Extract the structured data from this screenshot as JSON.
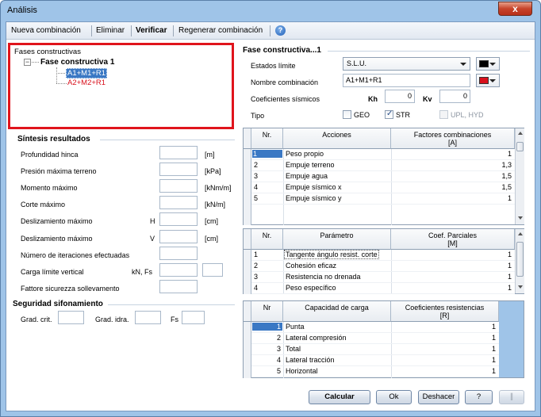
{
  "window": {
    "title": "Análisis",
    "close_glyph": "x"
  },
  "toolbar": {
    "new_combination": "Nueva combinación",
    "delete": "Eliminar",
    "verify": "Verificar",
    "regenerate": "Regenerar combinación",
    "help_glyph": "?"
  },
  "tree": {
    "root": "Fases constructivas",
    "phase": "Fase constructiva 1",
    "combinations": [
      "A1+M1+R1",
      "A2+M2+R1"
    ]
  },
  "synthesis": {
    "title": "Síntesis resultados",
    "rows": [
      {
        "label": "Profundidad  hinca",
        "value": "",
        "unit": "[m]"
      },
      {
        "label": "Presión máxima terreno",
        "value": "",
        "unit": "[kPa]"
      },
      {
        "label": "Momento máximo",
        "value": "",
        "unit": "[kNm/m]"
      },
      {
        "label": "Corte máximo",
        "value": "",
        "unit": "[kN/m]"
      },
      {
        "label": "Deslizamiento máximo",
        "sub": "H",
        "value": "",
        "unit": "[cm]"
      },
      {
        "label": "Deslizamiento máximo",
        "sub": "V",
        "value": "",
        "unit": "[cm]"
      },
      {
        "label": "Número de iteraciones efectuadas",
        "value": "",
        "unit": ""
      },
      {
        "label": "Carga límite vertical",
        "sub": "kN, Fs",
        "value": "",
        "value2": "",
        "unit": ""
      },
      {
        "label": "Fattore sicurezza sollevamento",
        "value": "",
        "unit": ""
      }
    ]
  },
  "siphon": {
    "title": "Seguridad sifonamiento",
    "crit_label": "Grad. crit.",
    "idra_label": "Grad. idra.",
    "fs_label": "Fs",
    "crit_value": "",
    "idra_value": "",
    "fs_value": ""
  },
  "phase_panel": {
    "title": "Fase constructiva...1",
    "limit_states_label": "Estados límite",
    "limit_state_value": "S.L.U.",
    "combination_name_label": "Nombre combinación",
    "combination_name_value": "A1+M1+R1",
    "seismic_label": "Coeficientes sísmicos",
    "kh_label": "Kh",
    "kh_value": "0",
    "kv_label": "Kv",
    "kv_value": "0",
    "type_label": "Tipo",
    "geo_label": "GEO",
    "str_label": "STR",
    "upl_label": "UPL, HYD",
    "color1": "#000000",
    "color2": "#d8101c"
  },
  "actions_table": {
    "headers": [
      "Nr.",
      "Acciones",
      "Factores combinaciones\n[A]"
    ],
    "rows": [
      {
        "nr": "1",
        "name": "Peso propio",
        "factor": "1"
      },
      {
        "nr": "2",
        "name": "Empuje terreno",
        "factor": "1,3"
      },
      {
        "nr": "3",
        "name": "Empuje agua",
        "factor": "1,5"
      },
      {
        "nr": "4",
        "name": "Empuje sísmico x",
        "factor": "1,5"
      },
      {
        "nr": "5",
        "name": "Empuje sísmico y",
        "factor": "1"
      }
    ]
  },
  "params_table": {
    "headers": [
      "Nr.",
      "Parámetro",
      "Coef. Parciales\n[M]"
    ],
    "rows": [
      {
        "nr": "1",
        "name": "Tangente ángulo resist. corte",
        "factor": "1"
      },
      {
        "nr": "2",
        "name": "Cohesión eficaz",
        "factor": "1"
      },
      {
        "nr": "3",
        "name": "Resistencia no drenada",
        "factor": "1"
      },
      {
        "nr": "4",
        "name": "Peso específico",
        "factor": "1"
      }
    ]
  },
  "capacity_table": {
    "headers": [
      "Nr",
      "Capacidad de carga",
      "Coeficientes resistencias\n[R]"
    ],
    "rows": [
      {
        "nr": "1",
        "name": "Punta",
        "factor": "1"
      },
      {
        "nr": "2",
        "name": "Lateral compresión",
        "factor": "1"
      },
      {
        "nr": "3",
        "name": "Total",
        "factor": "1"
      },
      {
        "nr": "4",
        "name": "Lateral tracción",
        "factor": "1"
      },
      {
        "nr": "5",
        "name": "Horizontal",
        "factor": "1"
      }
    ]
  },
  "buttons": {
    "calculate": "Calcular",
    "ok": "Ok",
    "undo": "Deshacer",
    "help": "?",
    "extra": "∥"
  }
}
